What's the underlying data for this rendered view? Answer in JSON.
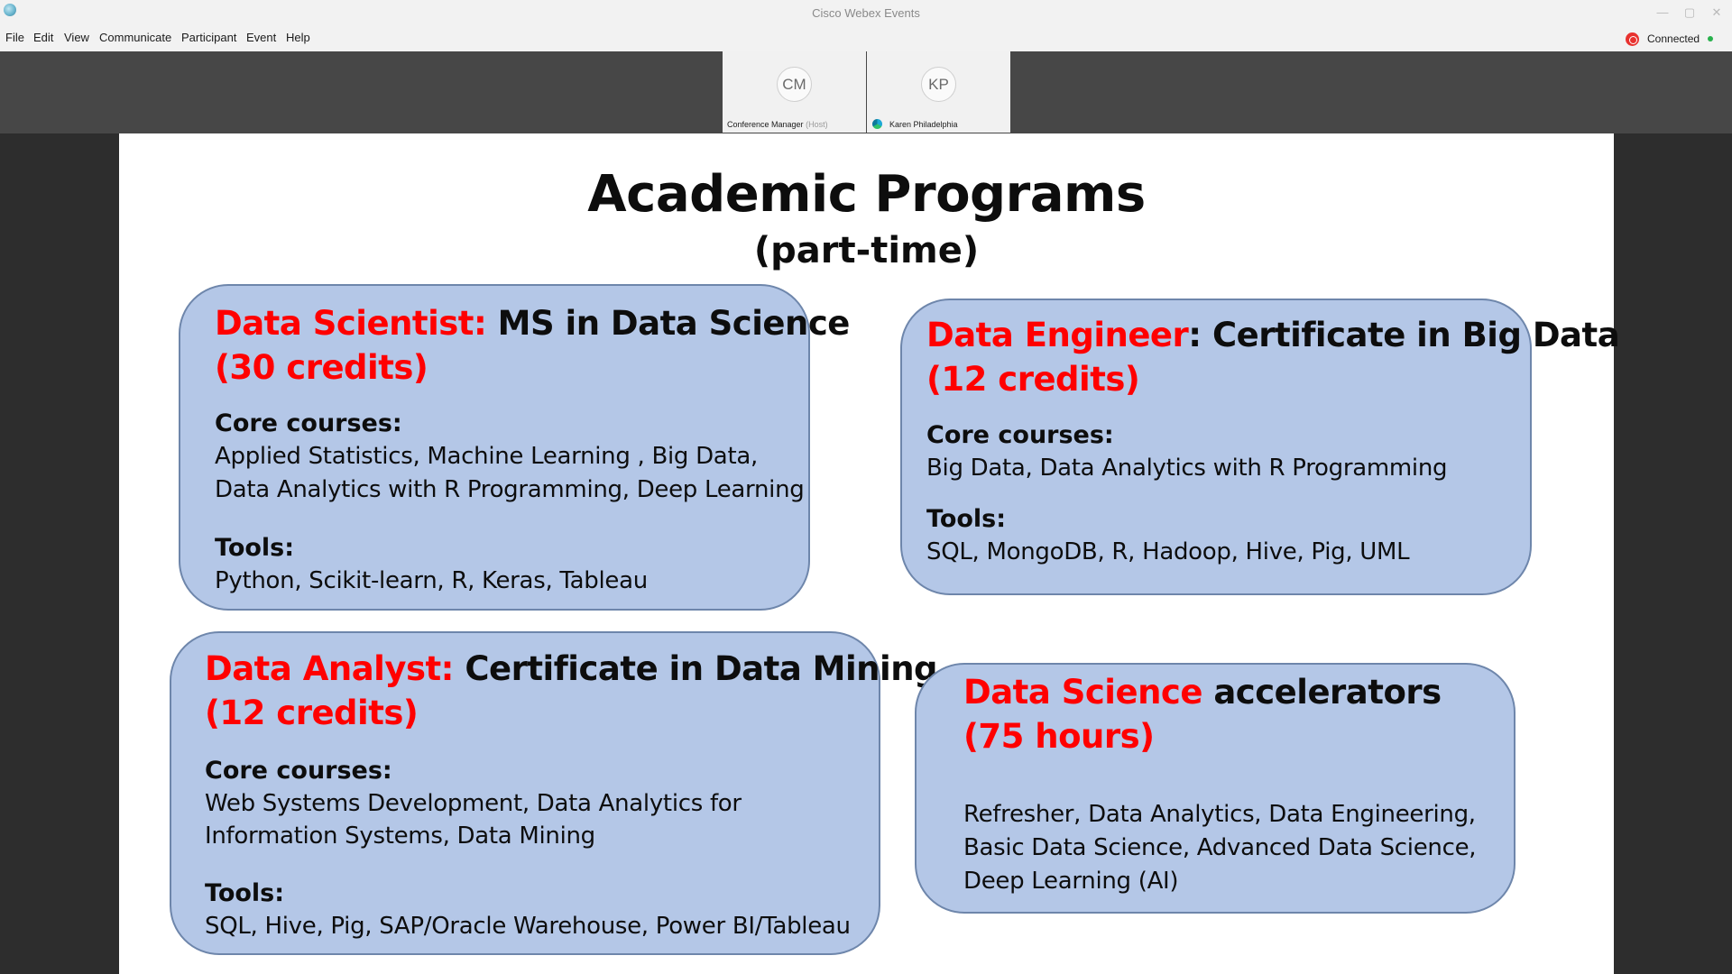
{
  "window": {
    "title": "Cisco Webex Events",
    "controls": {
      "minimize": "—",
      "maximize": "▢",
      "close": "✕"
    }
  },
  "menu": {
    "items": [
      "File",
      "Edit",
      "View",
      "Communicate",
      "Participant",
      "Event",
      "Help"
    ]
  },
  "status": {
    "label": "Connected",
    "indicator_color": "#28b14c",
    "ring_color": "#e8322f"
  },
  "participants": [
    {
      "initials": "CM",
      "name": "Conference Manager",
      "role": "(Host)"
    },
    {
      "initials": "KP",
      "name": "Karen Philadelphia",
      "role": ""
    }
  ],
  "slide": {
    "title": "Academic Programs",
    "subtitle": "(part-time)",
    "colors": {
      "box_fill": "#b4c7e7",
      "box_border": "#6e86ab",
      "accent_red": "#ff0000"
    },
    "boxes": {
      "data_scientist": {
        "role": "Data Scientist:",
        "program": " MS in Data Science",
        "credits": "(30 credits)",
        "core_label": "Core courses:",
        "core_lines": [
          "Applied Statistics, Machine Learning , Big Data,",
          "Data Analytics with R Programming, Deep Learning"
        ],
        "tools_label": "Tools:",
        "tools": "Python, Scikit-learn, R, Keras, Tableau"
      },
      "data_engineer": {
        "role": "Data Engineer",
        "program": ": Certificate in Big Data",
        "credits": "(12 credits)",
        "core_label": "Core courses:",
        "core_lines": [
          "Big Data, Data Analytics with R Programming"
        ],
        "tools_label": "Tools:",
        "tools": "SQL, MongoDB, R, Hadoop, Hive, Pig, UML"
      },
      "data_analyst": {
        "role": "Data Analyst:",
        "program": " Certificate in Data Mining",
        "credits": "(12 credits)",
        "core_label": "Core courses:",
        "core_lines": [
          "Web Systems Development, Data Analytics for",
          "Information Systems, Data Mining"
        ],
        "tools_label": "Tools:",
        "tools": "SQL, Hive, Pig, SAP/Oracle Warehouse, Power BI/Tableau"
      },
      "accelerators": {
        "role": "Data Science",
        "program": " accelerators",
        "credits": "(75 hours)",
        "lines": [
          "Refresher, Data Analytics, Data Engineering,",
          "Basic Data Science,  Advanced Data Science,",
          "Deep Learning (AI)"
        ]
      }
    }
  }
}
